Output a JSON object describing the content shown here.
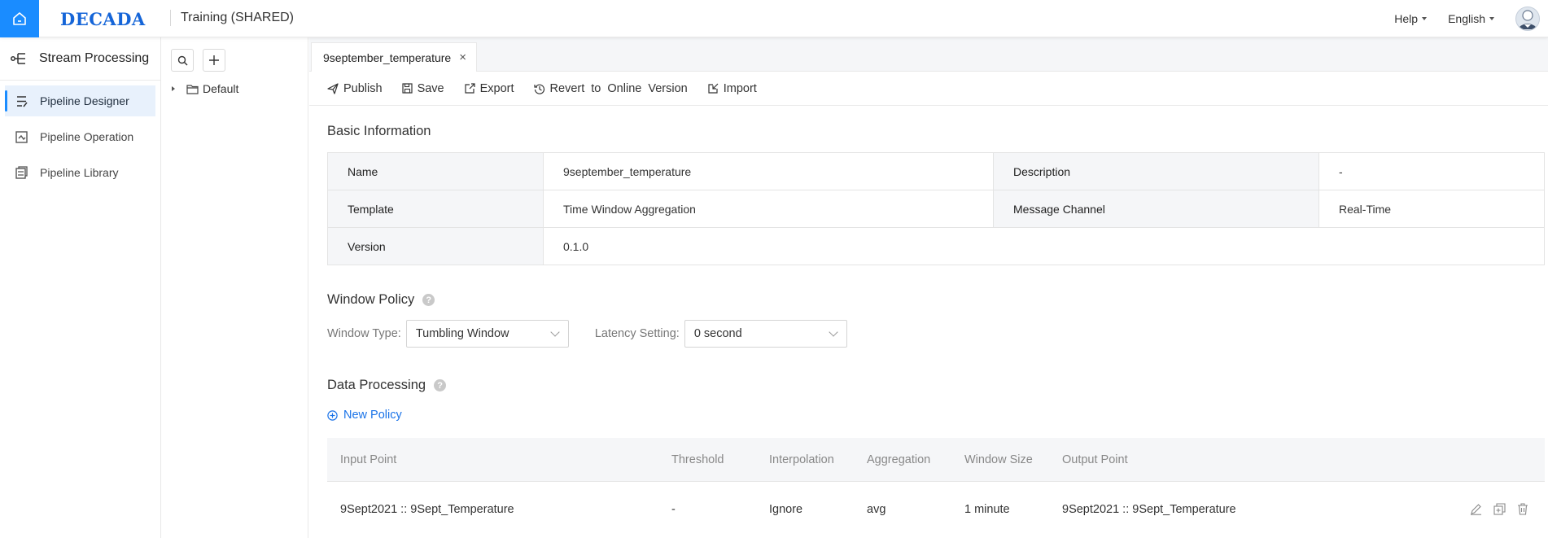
{
  "topbar": {
    "logo": "DECADA",
    "org_name": "Training (SHARED)",
    "help_label": "Help",
    "language_label": "English"
  },
  "sidebar": {
    "title": "Stream Processing",
    "items": [
      {
        "label": "Pipeline Designer",
        "active": true
      },
      {
        "label": "Pipeline Operation",
        "active": false
      },
      {
        "label": "Pipeline Library",
        "active": false
      }
    ]
  },
  "tree": {
    "root_label": "Default"
  },
  "tab": {
    "label": "9september_temperature",
    "close": "×"
  },
  "toolbar": {
    "publish": "Publish",
    "save": "Save",
    "export": "Export",
    "revert": "Revert to Online Version",
    "import": "Import"
  },
  "basic_info": {
    "title": "Basic Information",
    "name_label": "Name",
    "name_value": "9september_temperature",
    "description_label": "Description",
    "description_value": "-",
    "template_label": "Template",
    "template_value": "Time Window Aggregation",
    "message_channel_label": "Message Channel",
    "message_channel_value": "Real-Time",
    "version_label": "Version",
    "version_value": "0.1.0"
  },
  "window_policy": {
    "title": "Window Policy",
    "window_type_label": "Window Type:",
    "window_type_value": "Tumbling Window",
    "latency_label": "Latency Setting:",
    "latency_value": "0 second"
  },
  "data_processing": {
    "title": "Data Processing",
    "new_policy": "New Policy",
    "columns": [
      "Input Point",
      "Threshold",
      "Interpolation",
      "Aggregation",
      "Window Size",
      "Output Point"
    ],
    "rows": [
      {
        "input_point": "9Sept2021 :: 9Sept_Temperature",
        "threshold": "-",
        "interpolation": "Ignore",
        "aggregation": "avg",
        "window_size": "1 minute",
        "output_point": "9Sept2021 :: 9Sept_Temperature"
      }
    ]
  },
  "colors": {
    "accent": "#1a8cff",
    "logo": "#1565d8",
    "link": "#1a73e8"
  }
}
